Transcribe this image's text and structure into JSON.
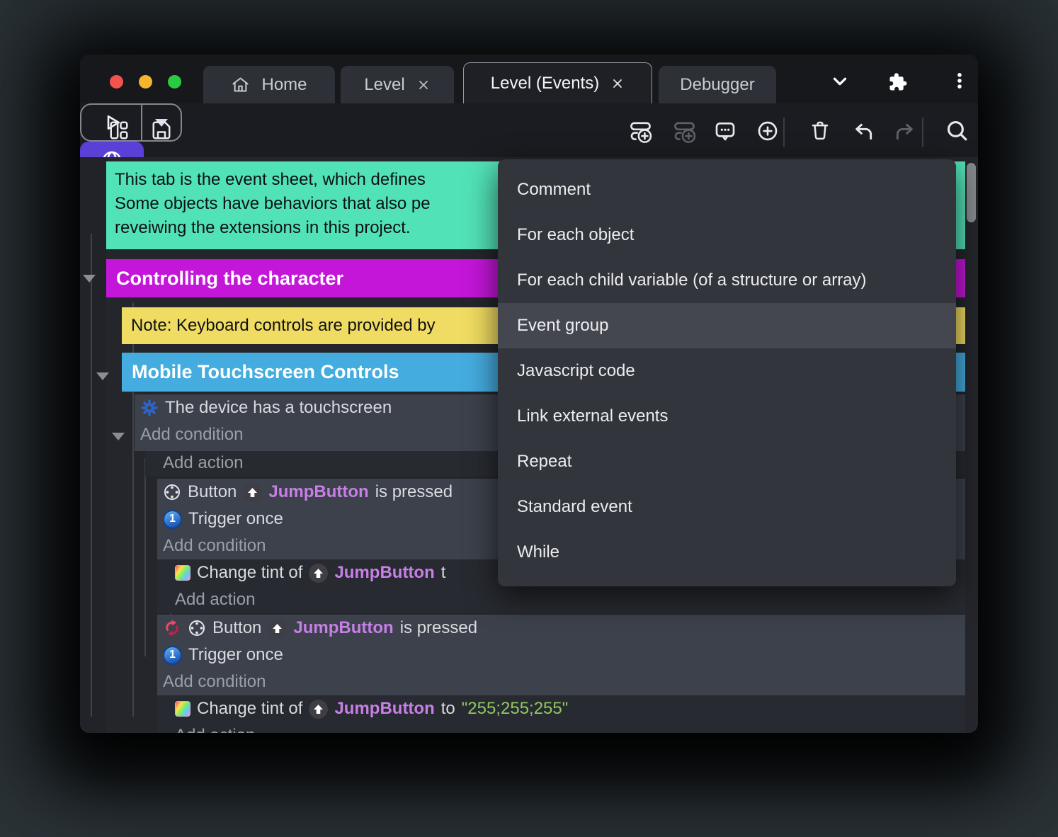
{
  "window": {
    "traffic_lights": {
      "close": "#F2544D",
      "minimize": "#F5B52E",
      "zoom": "#2ACB42"
    },
    "tabs": [
      {
        "label": "Home",
        "active": false,
        "closable": false
      },
      {
        "label": "Level",
        "active": false,
        "closable": true
      },
      {
        "label": "Level (Events)",
        "active": true,
        "closable": true
      },
      {
        "label": "Debugger",
        "active": false,
        "closable": false
      }
    ]
  },
  "toolbar": {
    "accent_color": "#5B40D8",
    "icons": [
      "dashboard",
      "save",
      "play",
      "dropdown-caret",
      "network-preview-globe",
      "add-event",
      "add-subevent",
      "add-comment",
      "add-circle",
      "trash",
      "undo",
      "redo",
      "search"
    ]
  },
  "event_sheet": {
    "comment": {
      "color": "#52E2B8",
      "lines": [
        "This tab is the event sheet, which defines",
        "Some objects have behaviors that also pe",
        "reveiwing the extensions in this project."
      ]
    },
    "group1": {
      "label": "Controlling the character",
      "color": "#C316D8"
    },
    "note": {
      "text": "Note: Keyboard controls are provided by",
      "color": "#F0DC62"
    },
    "group2": {
      "label": "Mobile Touchscreen Controls",
      "color": "#45ACDF"
    },
    "labels": {
      "add_condition": "Add condition",
      "add_action": "Add action"
    },
    "event1": {
      "condition": "The device has a touchscreen"
    },
    "sub_event_1": {
      "condition": {
        "prefix": "Button",
        "object": "JumpButton",
        "suffix": "is pressed"
      },
      "trigger_once": "Trigger once",
      "action": {
        "prefix": "Change tint of",
        "object": "JumpButton",
        "suffix": "t"
      }
    },
    "sub_event_2": {
      "inverted": true,
      "condition": {
        "prefix": "Button",
        "object": "JumpButton",
        "suffix": "is pressed"
      },
      "trigger_once": "Trigger once",
      "action": {
        "prefix": "Change tint of",
        "object": "JumpButton",
        "suffix": "to",
        "value": "\"255;255;255\""
      }
    },
    "object_color": "#C77FE6",
    "string_color": "#90C961"
  },
  "context_menu": {
    "highlight_color": "#44474F",
    "items": [
      {
        "label": "Comment",
        "highlighted": false
      },
      {
        "label": "For each object",
        "highlighted": false
      },
      {
        "label": "For each child variable (of a structure or array)",
        "highlighted": false
      },
      {
        "label": "Event group",
        "highlighted": true
      },
      {
        "label": "Javascript code",
        "highlighted": false
      },
      {
        "label": "Link external events",
        "highlighted": false
      },
      {
        "label": "Repeat",
        "highlighted": false
      },
      {
        "label": "Standard event",
        "highlighted": false
      },
      {
        "label": "While",
        "highlighted": false
      }
    ]
  },
  "icons": {
    "trigger_once_glyph": "1"
  }
}
